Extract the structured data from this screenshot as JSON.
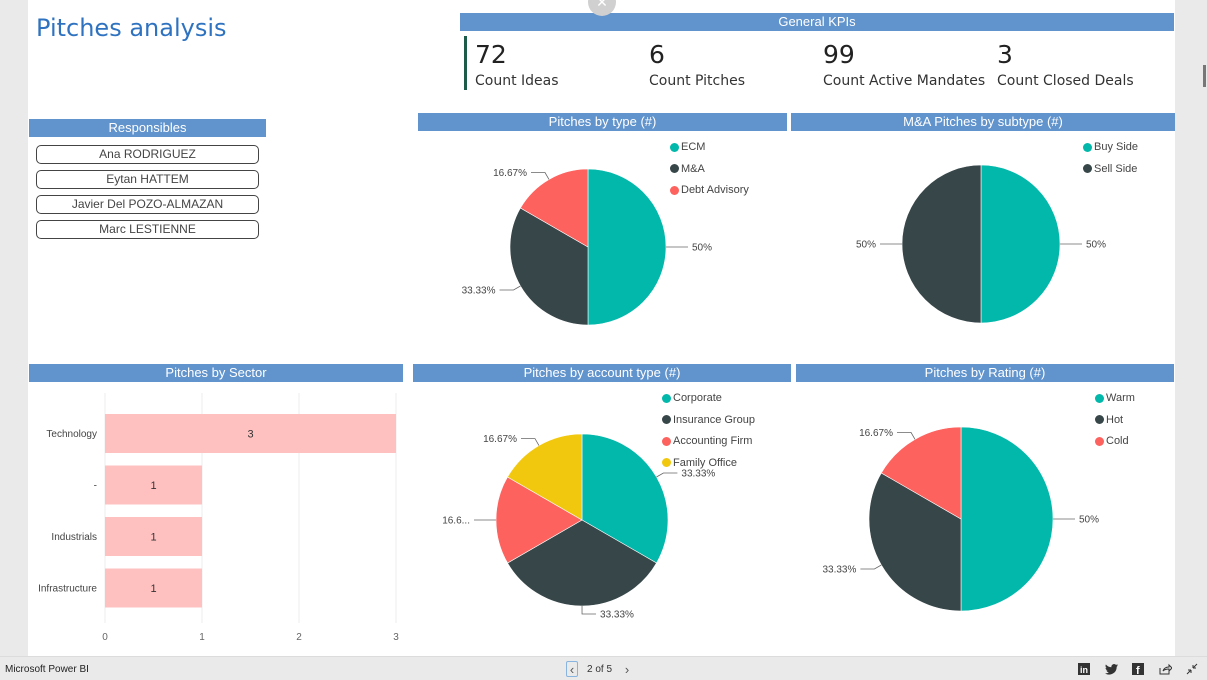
{
  "app": {
    "name": "Microsoft Power BI"
  },
  "page": {
    "title": "Pitches analysis",
    "current": 2,
    "total": 5,
    "pager_text": "2 of 5"
  },
  "kpis": {
    "header": "General KPIs",
    "items": [
      {
        "value": "72",
        "label": "Count Ideas"
      },
      {
        "value": "6",
        "label": "Count Pitches"
      },
      {
        "value": "99",
        "label": "Count Active Mandates"
      },
      {
        "value": "3",
        "label": "Count Closed Deals"
      }
    ]
  },
  "responsibles": {
    "header": "Responsibles",
    "items": [
      "Ana RODRIGUEZ",
      "Eytan HATTEM",
      "Javier Del POZO-ALMAZAN",
      "Marc LESTIENNE"
    ]
  },
  "colors": {
    "header_bg": "#6193cc",
    "title": "#2f73c0",
    "teal": "#01b8aa",
    "dark": "#374649",
    "red": "#fd625e",
    "yellow": "#f2c80f",
    "bar": "#ffc0c0"
  },
  "footer": {
    "prev_icon": "chevron-left-icon",
    "next_icon": "chevron-right-icon",
    "social": [
      "linkedin-icon",
      "twitter-icon",
      "facebook-icon",
      "share-icon",
      "exit-fullscreen-icon"
    ]
  },
  "chart_data": [
    {
      "id": "type",
      "type": "pie",
      "title": "Pitches by type (#)",
      "legend_position": "top-right",
      "slices": [
        {
          "name": "ECM",
          "value": 50,
          "label": "50%",
          "color": "#01b8aa"
        },
        {
          "name": "M&A",
          "value": 33.33,
          "label": "33.33%",
          "color": "#374649"
        },
        {
          "name": "Debt Advisory",
          "value": 16.67,
          "label": "16.67%",
          "color": "#fd625e"
        }
      ]
    },
    {
      "id": "subtype",
      "type": "pie",
      "title": "M&A Pitches by subtype (#)",
      "legend_position": "top-right",
      "slices": [
        {
          "name": "Buy Side",
          "value": 50,
          "label": "50%",
          "color": "#01b8aa"
        },
        {
          "name": "Sell Side",
          "value": 50,
          "label": "50%",
          "color": "#374649"
        }
      ]
    },
    {
      "id": "sector",
      "type": "bar",
      "orientation": "horizontal",
      "title": "Pitches by Sector",
      "categories": [
        "Technology",
        "-",
        "Industrials",
        "Infrastructure"
      ],
      "values": [
        3,
        1,
        1,
        1
      ],
      "xlim": [
        0,
        3
      ],
      "xticks": [
        "0",
        "1",
        "2",
        "3"
      ],
      "grid": true,
      "color": "#ffc0c0"
    },
    {
      "id": "account",
      "type": "pie",
      "title": "Pitches by account type (#)",
      "legend_position": "top-right",
      "slices": [
        {
          "name": "Corporate",
          "value": 33.33,
          "label": "33.33%",
          "color": "#01b8aa"
        },
        {
          "name": "Insurance Group",
          "value": 33.33,
          "label": "33.33%",
          "color": "#374649"
        },
        {
          "name": "Accounting Firm",
          "value": 16.67,
          "label": "16.6...",
          "color": "#fd625e"
        },
        {
          "name": "Family Office",
          "value": 16.67,
          "label": "16.67%",
          "color": "#f2c80f"
        }
      ]
    },
    {
      "id": "rating",
      "type": "pie",
      "title": "Pitches by Rating (#)",
      "legend_position": "top-right",
      "slices": [
        {
          "name": "Warm",
          "value": 50,
          "label": "50%",
          "color": "#01b8aa"
        },
        {
          "name": "Hot",
          "value": 33.33,
          "label": "33.33%",
          "color": "#374649"
        },
        {
          "name": "Cold",
          "value": 16.67,
          "label": "16.67%",
          "color": "#fd625e"
        }
      ]
    }
  ]
}
